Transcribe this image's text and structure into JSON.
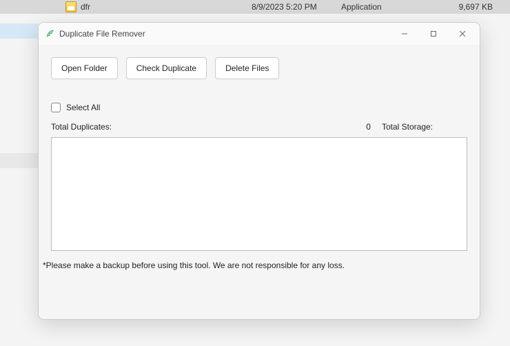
{
  "explorer": {
    "file_name": "dfr",
    "date_modified": "8/9/2023 5:20 PM",
    "type": "Application",
    "size": "9,697 KB"
  },
  "window": {
    "title": "Duplicate File Remover"
  },
  "toolbar": {
    "open_folder": "Open Folder",
    "check_duplicate": "Check Duplicate",
    "delete_files": "Delete Files"
  },
  "controls": {
    "select_all_label": "Select All"
  },
  "stats": {
    "total_duplicates_label": "Total Duplicates:",
    "total_duplicates_value": "0",
    "total_storage_label": "Total Storage:"
  },
  "disclaimer": "*Please make a backup before using this tool. We are not responsible for any loss."
}
